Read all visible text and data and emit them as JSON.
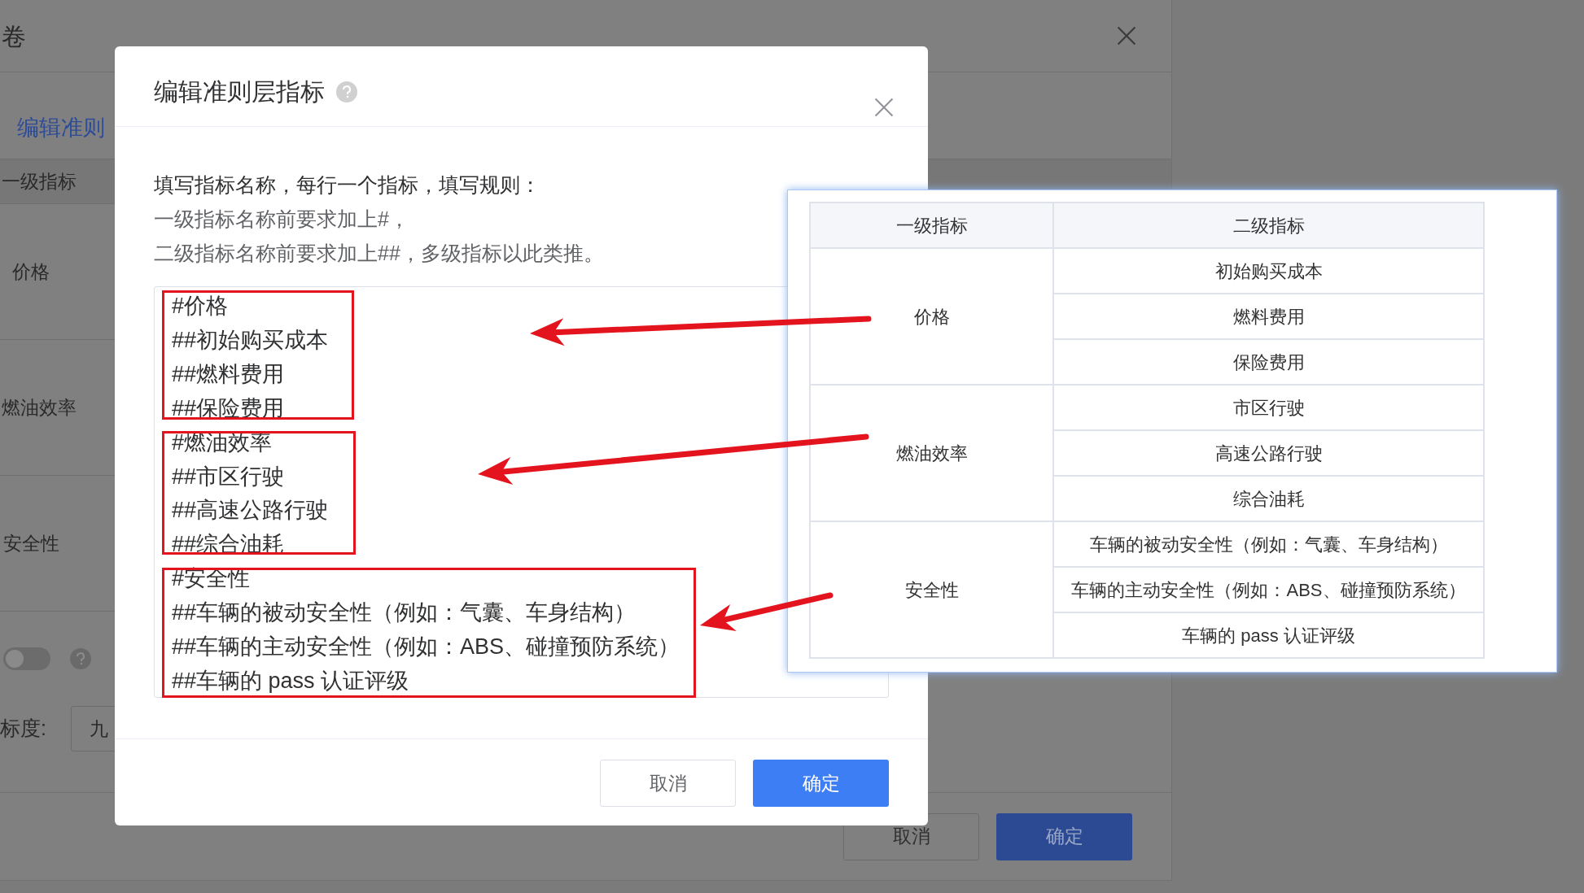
{
  "background_dialog": {
    "title": "卷",
    "tab": "编辑准则",
    "table_header": "一级指标",
    "table_rows": [
      "价格",
      "燃油效率",
      "安全性"
    ],
    "toggle": {
      "on": false
    },
    "scale": {
      "label": "标度:",
      "value": "九"
    },
    "buttons": [
      {
        "label": "取消",
        "kind": "default"
      },
      {
        "label": "确定",
        "kind": "primary"
      }
    ]
  },
  "dialog": {
    "title": "编辑准则层指标",
    "instructions": [
      {
        "text": "填写指标名称，每行一个指标，填写规则：",
        "kind": "lead"
      },
      {
        "text": "一级指标名称前要求加上#，",
        "kind": "rule"
      },
      {
        "text": "二级指标名称前要求加上##，多级指标以此类推。",
        "kind": "rule"
      }
    ],
    "textarea_lines": [
      "#价格",
      "##初始购买成本",
      "##燃料费用",
      "##保险费用",
      "#燃油效率",
      "##市区行驶",
      "##高速公路行驶",
      "##综合油耗",
      "#安全性",
      "##车辆的被动安全性（例如：气囊、车身结构）",
      "##车辆的主动安全性（例如：ABS、碰撞预防系统）",
      "##车辆的 pass 认证评级"
    ],
    "buttons": [
      {
        "label": "取消",
        "kind": "default"
      },
      {
        "label": "确定",
        "kind": "primary"
      }
    ]
  },
  "callout_table": {
    "columns": [
      "一级指标",
      "二级指标"
    ],
    "groups": [
      {
        "name": "价格",
        "children": [
          "初始购买成本",
          "燃料费用",
          "保险费用"
        ]
      },
      {
        "name": "燃油效率",
        "children": [
          "市区行驶",
          "高速公路行驶",
          "综合油耗"
        ]
      },
      {
        "name": "安全性",
        "children": [
          "车辆的被动安全性（例如：气囊、车身结构）",
          "车辆的主动安全性（例如：ABS、碰撞预防系统）",
          "车辆的 pass 认证评级"
        ]
      }
    ]
  }
}
